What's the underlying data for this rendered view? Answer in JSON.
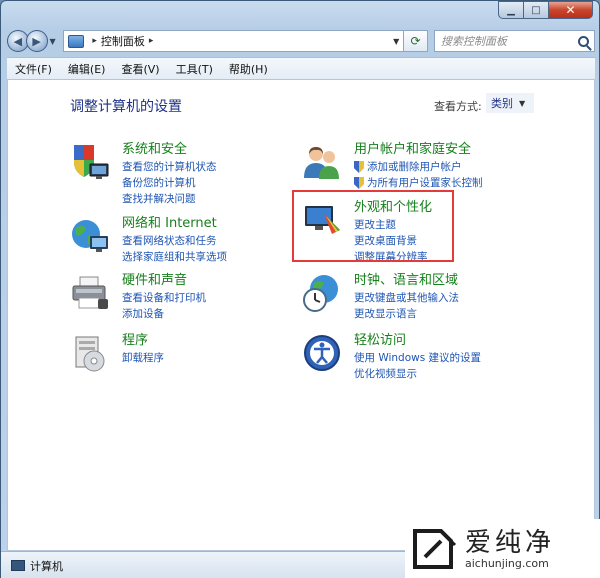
{
  "navigation": {
    "breadcrumb_separator": "▸",
    "location": "控制面板",
    "location_suffix": "▸",
    "search_placeholder": "搜索控制面板"
  },
  "menu": [
    "文件(F)",
    "编辑(E)",
    "查看(V)",
    "工具(T)",
    "帮助(H)"
  ],
  "main": {
    "title": "调整计算机的设置",
    "view_by_label": "查看方式:",
    "view_by_value": "类别"
  },
  "categories": [
    {
      "id": "system-security",
      "icon": "shield-computer-icon",
      "title": "系统和安全",
      "links": [
        "查看您的计算机状态",
        "备份您的计算机",
        "查找并解决问题"
      ]
    },
    {
      "id": "network-internet",
      "icon": "globe-network-icon",
      "title": "网络和 Internet",
      "links": [
        "查看网络状态和任务",
        "选择家庭组和共享选项"
      ]
    },
    {
      "id": "hardware-sound",
      "icon": "printer-icon",
      "title": "硬件和声音",
      "links": [
        "查看设备和打印机",
        "添加设备"
      ]
    },
    {
      "id": "programs",
      "icon": "programs-icon",
      "title": "程序",
      "links": [
        "卸载程序"
      ]
    },
    {
      "id": "user-accounts",
      "icon": "users-icon",
      "title": "用户帐户和家庭安全",
      "links": [
        "添加或删除用户帐户",
        "为所有用户设置家长控制"
      ]
    },
    {
      "id": "appearance",
      "icon": "appearance-icon",
      "title": "外观和个性化",
      "links": [
        "更改主题",
        "更改桌面背景",
        "调整屏幕分辨率"
      ]
    },
    {
      "id": "clock-language",
      "icon": "clock-globe-icon",
      "title": "时钟、语言和区域",
      "links": [
        "更改键盘或其他输入法",
        "更改显示语言"
      ]
    },
    {
      "id": "ease-access",
      "icon": "ease-of-access-icon",
      "title": "轻松访问",
      "links": [
        "使用 Windows 建议的设置",
        "优化视频显示"
      ]
    }
  ],
  "status": {
    "text": "计算机"
  },
  "watermark": {
    "title": "爱纯净",
    "url": "aichunjing.com"
  },
  "colors": {
    "category_title": "#16801b",
    "link": "#1e55b3",
    "page_title": "#1e3287",
    "highlight": "#e53a3a"
  }
}
